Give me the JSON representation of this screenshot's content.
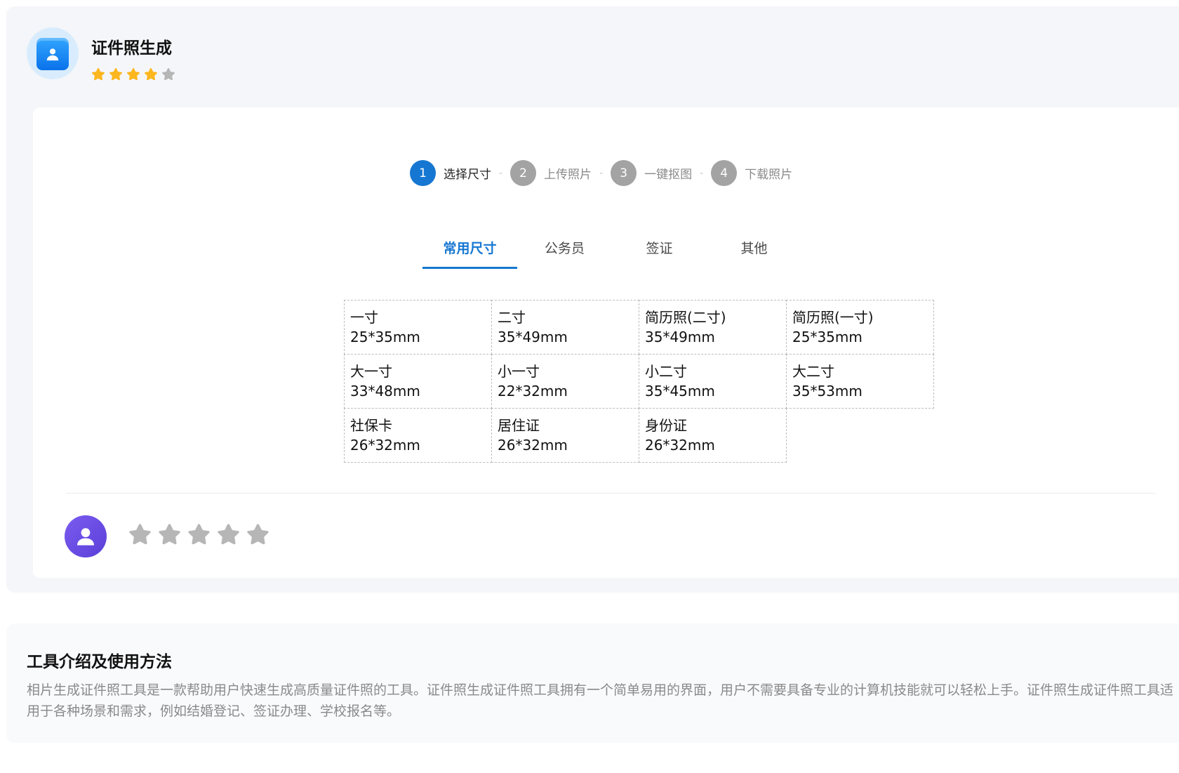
{
  "app": {
    "title": "证件照生成",
    "rating": 4,
    "rating_max": 5,
    "star_color": "#fcb61e",
    "star_empty_color": "#b6b6b6"
  },
  "steps": [
    {
      "num": "1",
      "label": "选择尺寸",
      "active": true
    },
    {
      "num": "2",
      "label": "上传照片",
      "active": false
    },
    {
      "num": "3",
      "label": "一键抠图",
      "active": false
    },
    {
      "num": "4",
      "label": "下载照片",
      "active": false
    }
  ],
  "step_separator": "-",
  "tabs": [
    {
      "label": "常用尺寸",
      "active": true
    },
    {
      "label": "公务员",
      "active": false
    },
    {
      "label": "签证",
      "active": false
    },
    {
      "label": "其他",
      "active": false
    }
  ],
  "sizes": [
    {
      "name": "一寸",
      "dim": "25*35mm"
    },
    {
      "name": "二寸",
      "dim": "35*49mm"
    },
    {
      "name": "简历照(二寸)",
      "dim": "35*49mm"
    },
    {
      "name": "简历照(一寸)",
      "dim": "25*35mm"
    },
    {
      "name": "大一寸",
      "dim": "33*48mm"
    },
    {
      "name": "小一寸",
      "dim": "22*32mm"
    },
    {
      "name": "小二寸",
      "dim": "35*45mm"
    },
    {
      "name": "大二寸",
      "dim": "35*53mm"
    },
    {
      "name": "社保卡",
      "dim": "26*32mm"
    },
    {
      "name": "居住证",
      "dim": "26*32mm"
    },
    {
      "name": "身份证",
      "dim": "26*32mm"
    }
  ],
  "user_rating": {
    "value": 0,
    "max": 5
  },
  "intro": {
    "title": "工具介绍及使用方法",
    "text": "相片生成证件照工具是一款帮助用户快速生成高质量证件照的工具。证件照生成证件照工具拥有一个简单易用的界面，用户不需要具备专业的计算机技能就可以轻松上手。证件照生成证件照工具适用于各种场景和需求，例如结婚登记、签证办理、学校报名等。"
  },
  "colors": {
    "accent": "#1677d2",
    "step_inactive": "#a3a3a3",
    "avatar": "#6a4ee6"
  }
}
